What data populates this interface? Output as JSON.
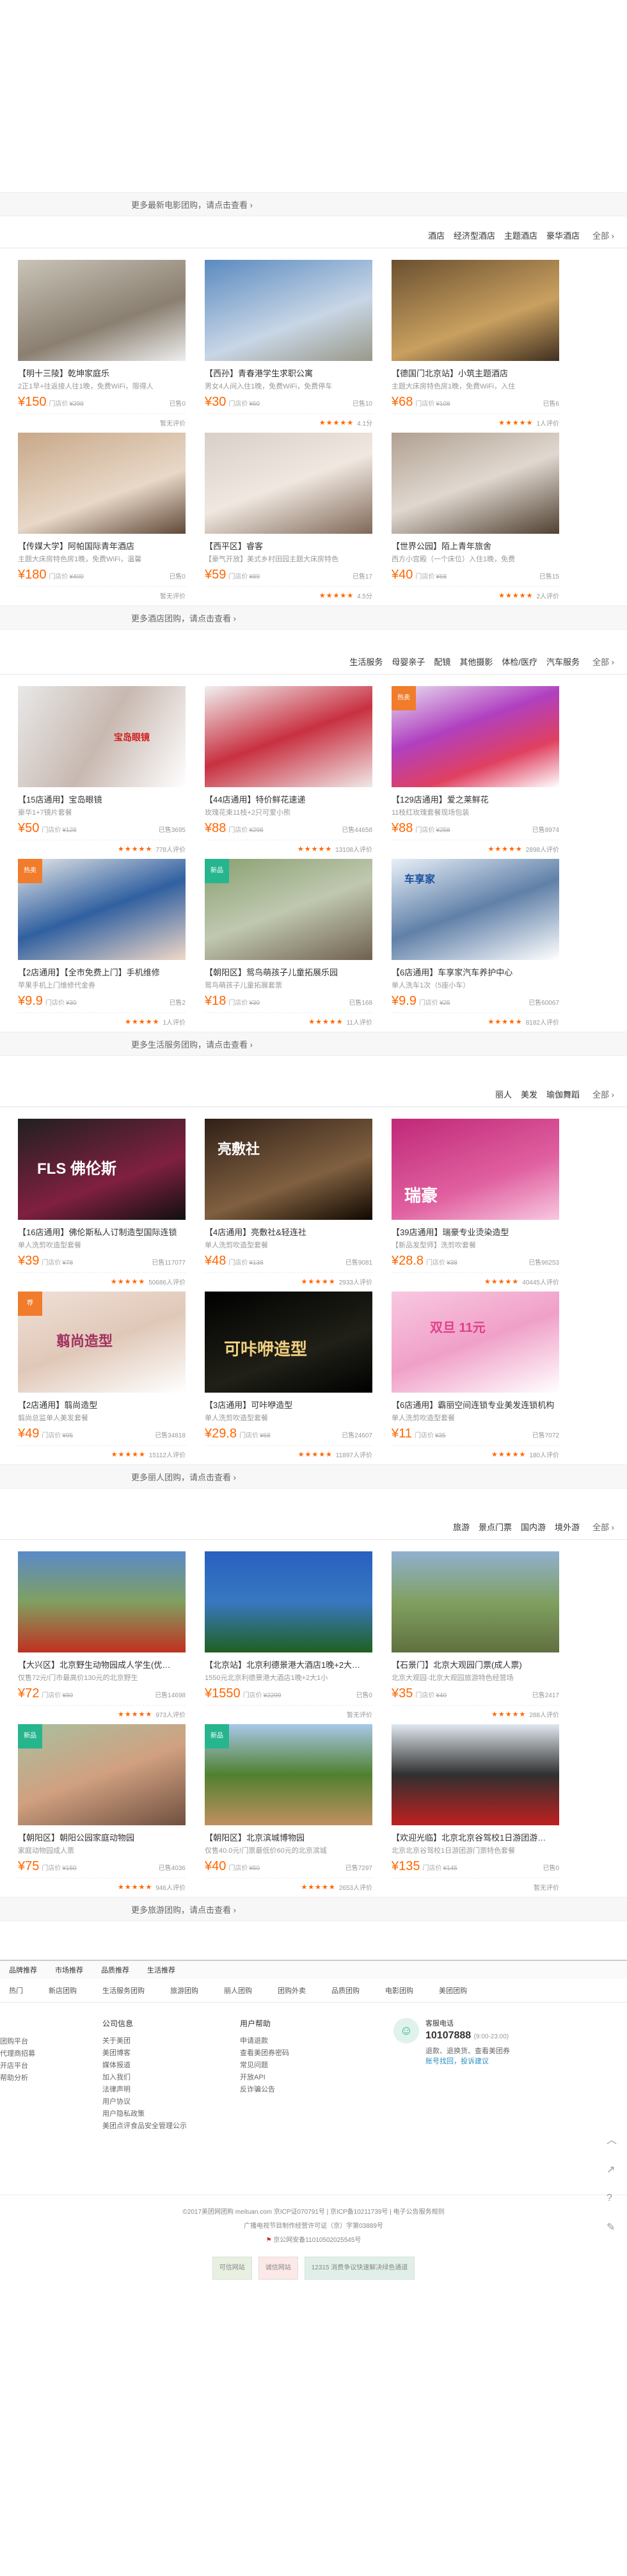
{
  "top_more": "更多最新电影团购，请点击查看 ›",
  "hotel": {
    "cats": [
      "酒店",
      "经济型酒店",
      "主题酒店",
      "豪华酒店"
    ],
    "all": "全部 ›",
    "more": "更多酒店团购，请点击查看 ›",
    "items": [
      {
        "title": "【明十三陵】乾坤家庭乐",
        "desc": "2正1早+往返接人往1晚，免费WiFi，限得人",
        "price": "¥150",
        "mp_label": "门店价",
        "mp": "¥299",
        "sold": "已售0",
        "rate": "暂无评价",
        "stars": ""
      },
      {
        "title": "【西孙】青春港学生求职公寓",
        "desc": "男女4人间入住1晚，免费WiFi，免费停车",
        "price": "¥30",
        "mp_label": "门店价",
        "mp": "¥60",
        "sold": "已售10",
        "rate": "4.1分",
        "stars": "★★★★★"
      },
      {
        "title": "【德国门北京站】小筑主题酒店",
        "desc": "主题大床房特色房1晚，免费WiFi，入住",
        "price": "¥68",
        "mp_label": "门店价",
        "mp": "¥108",
        "sold": "已售6",
        "rate": "1人评价",
        "stars": "★★★★★"
      },
      {
        "title": "【传媒大学】阿帕国际青年酒店",
        "desc": "主题大床房特色房1晚，免费WiFi，温馨",
        "price": "¥180",
        "mp_label": "门店价",
        "mp": "¥400",
        "sold": "已售0",
        "rate": "暂无评价",
        "stars": ""
      },
      {
        "title": "【西平区】睿客",
        "desc": "【豪气开放】美式乡村田园主题大床房特色",
        "price": "¥59",
        "mp_label": "门店价",
        "mp": "¥89",
        "sold": "已售17",
        "rate": "4.5分",
        "stars": "★★★★★"
      },
      {
        "title": "【世界公园】陌上青年旅舍",
        "desc": "西方小宫殿（一个床位）入住1晚，免费",
        "price": "¥40",
        "mp_label": "门店价",
        "mp": "¥68",
        "sold": "已售15",
        "rate": "2人评价",
        "stars": "★★★★★"
      }
    ]
  },
  "life": {
    "cats": [
      "生活服务",
      "母婴亲子",
      "配镜",
      "其他摄影",
      "体检/医疗",
      "汽车服务"
    ],
    "all": "全部 ›",
    "more": "更多生活服务团购，请点击查看 ›",
    "items": [
      {
        "title": "【15店通用】宝岛眼镜",
        "desc": "豪华1+7镜片套餐",
        "price": "¥50",
        "mp_label": "门店价",
        "mp": "¥128",
        "sold": "已售3695",
        "rate": "778人评价",
        "stars": "★★★★★",
        "tag": "",
        "img_text": "宝岛眼镜"
      },
      {
        "title": "【44店通用】特价鲜花速递",
        "desc": "玫瑰花束11枝+2只可爱小熊",
        "price": "¥88",
        "mp_label": "门店价",
        "mp": "¥298",
        "sold": "已售44658",
        "rate": "13108人评价",
        "stars": "★★★★★",
        "tag": "",
        "img_text": ""
      },
      {
        "title": "【129店通用】爱之莱鲜花",
        "desc": "11枝红玫瑰套餐现场包装",
        "price": "¥88",
        "mp_label": "门店价",
        "mp": "¥258",
        "sold": "已售8974",
        "rate": "2898人评价",
        "stars": "★★★★★",
        "tag": "热卖",
        "img_text": ""
      },
      {
        "title": "【2店通用】【全市免费上门】手机维修",
        "desc": "苹果手机上门维修代金券",
        "price": "¥9.9",
        "mp_label": "门店价",
        "mp": "¥30",
        "sold": "已售2",
        "rate": "1人评价",
        "stars": "★★★★★",
        "tag": "热卖",
        "img_text": ""
      },
      {
        "title": "【朝阳区】鸳鸟萌孩子儿童拓展乐园",
        "desc": "鸳鸟萌孩子儿童拓展套票",
        "price": "¥18",
        "mp_label": "门店价",
        "mp": "¥30",
        "sold": "已售168",
        "rate": "11人评价",
        "stars": "★★★★★",
        "tag": "新品",
        "img_text": ""
      },
      {
        "title": "【6店通用】车享家汽车养护中心",
        "desc": "单人洗车1次（5座小车）",
        "price": "¥9.9",
        "mp_label": "门店价",
        "mp": "¥25",
        "sold": "已售60067",
        "rate": "8182人评价",
        "stars": "★★★★★",
        "tag": "",
        "img_text": "车享家"
      }
    ]
  },
  "beauty": {
    "cats": [
      "丽人",
      "美发",
      "瑜伽舞蹈"
    ],
    "all": "全部 ›",
    "more": "更多丽人团购，请点击查看 ›",
    "items": [
      {
        "title": "【16店通用】佛伦斯私人订制造型国际连锁",
        "desc": "单人洗剪吹造型套餐",
        "price": "¥39",
        "mp_label": "门店价",
        "mp": "¥78",
        "sold": "已售117077",
        "rate": "50686人评价",
        "stars": "★★★★★",
        "tag": "",
        "img_text": "FLS 佛伦斯"
      },
      {
        "title": "【4店通用】亮敷社&轻连社",
        "desc": "单人洗剪吹造型套餐",
        "price": "¥48",
        "mp_label": "门店价",
        "mp": "¥138",
        "sold": "已售9081",
        "rate": "2933人评价",
        "stars": "★★★★★",
        "tag": "",
        "img_text": "亮敷社"
      },
      {
        "title": "【39店通用】瑞豪专业烫染造型",
        "desc": "【新品发型师】洗剪吹套餐",
        "price": "¥28.8",
        "mp_label": "门店价",
        "mp": "¥38",
        "sold": "已售96253",
        "rate": "40445人评价",
        "stars": "★★★★★",
        "tag": "",
        "img_text": "瑞豪"
      },
      {
        "title": "【2店通用】翦尚造型",
        "desc": "翦尚总监单人美发套餐",
        "price": "¥49",
        "mp_label": "门店价",
        "mp": "¥95",
        "sold": "已售34818",
        "rate": "15112人评价",
        "stars": "★★★★★",
        "tag": "荐",
        "img_text": "翦尚造型"
      },
      {
        "title": "【3店通用】可咔咿造型",
        "desc": "单人洗剪吹造型套餐",
        "price": "¥29.8",
        "mp_label": "门店价",
        "mp": "¥68",
        "sold": "已售24607",
        "rate": "11897人评价",
        "stars": "★★★★★",
        "tag": "",
        "img_text": "可咔咿造型"
      },
      {
        "title": "【6店通用】霸丽空间连锁专业美发连锁机构",
        "desc": "单人洗剪吹造型套餐",
        "price": "¥11",
        "mp_label": "门店价",
        "mp": "¥35",
        "sold": "已售7072",
        "rate": "180人评价",
        "stars": "★★★★★",
        "tag": "",
        "img_text": "双旦 11元"
      }
    ]
  },
  "travel": {
    "cats": [
      "旅游",
      "景点门票",
      "国内游",
      "境外游"
    ],
    "all": "全部 ›",
    "more": "更多旅游团购，请点击查看 ›",
    "items": [
      {
        "title": "【大兴区】北京野生动物园成人学生(优…",
        "desc": "仅售72元!门市最高价130元的北京野生",
        "price": "¥72",
        "mp_label": "门店价",
        "mp": "¥80",
        "sold": "已售14698",
        "rate": "973人评价",
        "stars": "★★★★★",
        "tag": ""
      },
      {
        "title": "【北京站】北京利德景港大酒店1晚+2大…",
        "desc": "1550元北京利德景港大酒店1晚+2大1小",
        "price": "¥1550",
        "mp_label": "门店价",
        "mp": "¥2299",
        "sold": "已售0",
        "rate": "暂无评价",
        "stars": "",
        "tag": ""
      },
      {
        "title": "【石景门】北京大观园门票(成人票)",
        "desc": "北京大观园-北京大观园旅游特色经营场",
        "price": "¥35",
        "mp_label": "门店价",
        "mp": "¥40",
        "sold": "已售2417",
        "rate": "288人评价",
        "stars": "★★★★★",
        "tag": ""
      },
      {
        "title": "【朝阳区】朝阳公园家庭动物园",
        "desc": "家庭动物园成人票",
        "price": "¥75",
        "mp_label": "门店价",
        "mp": "¥150",
        "sold": "已售4036",
        "rate": "946人评价",
        "stars": "★★★★★",
        "tag": "新品"
      },
      {
        "title": "【朝阳区】北京滨城博物园",
        "desc": "仅售40.0元!门票最低价60元的北京滨城",
        "price": "¥40",
        "mp_label": "门店价",
        "mp": "¥50",
        "sold": "已售7297",
        "rate": "2653人评价",
        "stars": "★★★★★",
        "tag": "新品"
      },
      {
        "title": "【欢迎光临】北京北京谷驾校1日游团游…",
        "desc": "北京北京谷驾校1日游团游门票特色套餐",
        "price": "¥135",
        "mp_label": "门店价",
        "mp": "¥145",
        "sold": "已售0",
        "rate": "暂无评价",
        "stars": "",
        "tag": ""
      }
    ]
  },
  "footer": {
    "tabs": [
      "品牌推荐",
      "市场推荐",
      "品质推荐",
      "生活推荐"
    ],
    "links": [
      "热门",
      "新店团购",
      "生活服务团购",
      "旅游团购",
      "丽人团购",
      "团购外卖",
      "品质团购",
      "电影团购",
      "美团团购"
    ],
    "cols": [
      {
        "title": "公司信息",
        "items": [
          "关于美团",
          "美团博客",
          "媒体报道",
          "加入我们",
          "法律声明",
          "用户协议",
          "用户隐私政策",
          "美团点评食品安全管理公示"
        ]
      },
      {
        "title": "用户帮助",
        "items": [
          "申请退款",
          "查看美团券密码",
          "常见问题",
          "开放API",
          "反诈骗公告"
        ]
      }
    ],
    "left_items": [
      "团购平台",
      "代理商招募",
      "开店平台",
      "帮助分析"
    ],
    "service": {
      "label": "客服电话",
      "phone": "10107888",
      "hours": "(9:00-23:00)",
      "note": "退款、退换货、查看美团券",
      "link": "账号找回，投诉建议"
    },
    "copyright": "©2017美团网团购 meituan.com 京ICP证070791号 | 京ICP备10211739号 | 电子公告服务规则",
    "license": "广播电视节目制作经营许可证（京）字第03889号",
    "police": "京公网安备11010502025545号",
    "badges": [
      "可信网站",
      "诚信网站",
      "12315 消费争议快速解决绿色通道"
    ]
  },
  "side_icons": [
    "chevron-up-icon",
    "share-icon",
    "question-icon",
    "edit-icon"
  ]
}
